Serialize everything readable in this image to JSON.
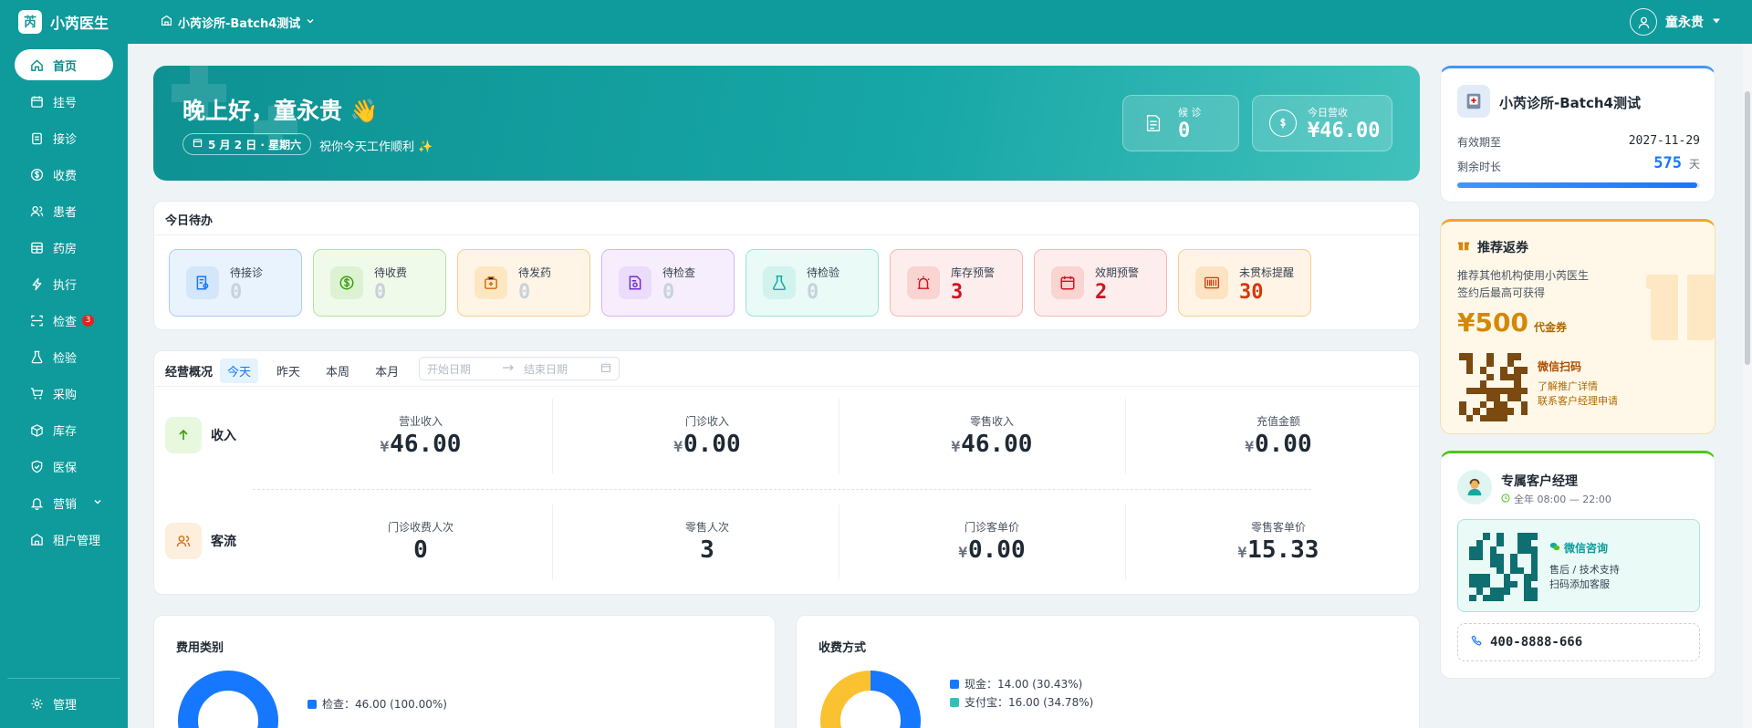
{
  "app": {
    "logo_char": "芮",
    "name": "小芮医生"
  },
  "topbar": {
    "clinic": "小芮诊所-Batch4测试",
    "user": "童永贵"
  },
  "sidebar": {
    "items": [
      {
        "label": "首页"
      },
      {
        "label": "挂号"
      },
      {
        "label": "接诊"
      },
      {
        "label": "收费"
      },
      {
        "label": "患者"
      },
      {
        "label": "药房"
      },
      {
        "label": "执行"
      },
      {
        "label": "检查",
        "badge": "3"
      },
      {
        "label": "检验"
      },
      {
        "label": "采购"
      },
      {
        "label": "库存"
      },
      {
        "label": "医保"
      },
      {
        "label": "营销"
      },
      {
        "label": "租户管理"
      }
    ],
    "bottom_label": "管理"
  },
  "hero": {
    "greeting": "晚上好，童永贵 👋",
    "date": "5 月 2 日 · 星期六",
    "wish": "祝你今天工作顺利 ✨",
    "waiting_label": "候 诊",
    "waiting_value": "0",
    "revenue_label": "今日营收",
    "revenue_value": "¥46.00"
  },
  "todo": {
    "title": "今日待办",
    "items": [
      {
        "label": "待接诊",
        "value": "0"
      },
      {
        "label": "待收费",
        "value": "0"
      },
      {
        "label": "待发药",
        "value": "0"
      },
      {
        "label": "待检查",
        "value": "0"
      },
      {
        "label": "待检验",
        "value": "0"
      },
      {
        "label": "库存预警",
        "value": "3"
      },
      {
        "label": "效期预警",
        "value": "2"
      },
      {
        "label": "未贯标提醒",
        "value": "30"
      }
    ]
  },
  "overview": {
    "title": "经营概况",
    "tabs": [
      "今天",
      "昨天",
      "本周",
      "本月"
    ],
    "start_placeholder": "开始日期",
    "end_placeholder": "结束日期",
    "currency": "¥",
    "income_label": "收入",
    "income": [
      {
        "label": "营业收入",
        "value": "46.00"
      },
      {
        "label": "门诊收入",
        "value": "0.00"
      },
      {
        "label": "零售收入",
        "value": "46.00"
      },
      {
        "label": "充值金额",
        "value": "0.00"
      }
    ],
    "traffic_label": "客流",
    "traffic": [
      {
        "label": "门诊收费人次",
        "value": "0"
      },
      {
        "label": "零售人次",
        "value": "3"
      },
      {
        "label": "门诊客单价",
        "value": "0.00"
      },
      {
        "label": "零售客单价",
        "value": "15.33"
      }
    ]
  },
  "fee": {
    "title": "费用类别",
    "legend": [
      "检查：46.00 (100.00%)"
    ]
  },
  "payment": {
    "title": "收费方式",
    "legend": [
      "现金：14.00 (30.43%)",
      "支付宝：16.00 (34.78%)"
    ]
  },
  "clinic_card": {
    "name": "小芮诊所-Batch4测试",
    "expire_label": "有效期至",
    "expire_value": "2027-11-29",
    "remain_label": "剩余时长",
    "remain_value": "575",
    "remain_unit": "天",
    "remain_progress": 0.99
  },
  "promo": {
    "title": "推荐返券",
    "line1": "推荐其他机构使用小芮医生",
    "line2": "签约后最高可获得",
    "amount": "¥500",
    "unit": "代金券",
    "qr_title": "微信扫码",
    "qr_line1": "了解推广详情",
    "qr_line2": "联系客户经理申请"
  },
  "manager": {
    "title": "专属客户经理",
    "hours": "全年 08:00 — 22:00",
    "qr_title": "微信咨询",
    "qr_line1": "售后 / 技术支持",
    "qr_line2": "扫码添加客服",
    "phone": "400-8888-666"
  },
  "colors": {
    "brand": "#0f9a9b",
    "blue": "#1677ff",
    "cyan": "#2fc3b8",
    "yellow": "#fac230",
    "warn": "#d4380d",
    "danger": "#cf1322"
  }
}
